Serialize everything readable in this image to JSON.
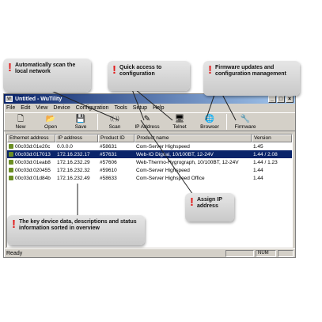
{
  "window": {
    "title": "Untitled - WuTility",
    "controls": {
      "minimize": "_",
      "maximize": "□",
      "close": "×"
    }
  },
  "menu": [
    "File",
    "Edit",
    "View",
    "Device",
    "Configuration",
    "Tools",
    "Setup",
    "Help"
  ],
  "toolbar": [
    {
      "label": "New",
      "icon": "new-document-icon",
      "glyph": "🗋"
    },
    {
      "label": "Open",
      "icon": "open-folder-icon",
      "glyph": "📂"
    },
    {
      "label": "Save",
      "icon": "save-disk-icon",
      "glyph": "💾"
    },
    {
      "label": "Scan",
      "icon": "scan-radar-icon",
      "glyph": "((·))"
    },
    {
      "label": "IP Address",
      "icon": "ip-address-icon",
      "glyph": "✎"
    },
    {
      "label": "Telnet",
      "icon": "telnet-terminal-icon",
      "glyph": "🖥"
    },
    {
      "label": "Browser",
      "icon": "browser-globe-icon",
      "glyph": "🌐"
    },
    {
      "label": "Firmware",
      "icon": "firmware-wrench-icon",
      "glyph": "🔧"
    }
  ],
  "table": {
    "columns": [
      "Ethernet address",
      "IP address",
      "Product ID",
      "Product name",
      "Version"
    ],
    "rows": [
      [
        "00c03d:01e20c",
        "0.0.0.0",
        "#58631",
        "Com-Server Highspeed",
        "1.45"
      ],
      [
        "00c03d:017013",
        "172.16.232.17",
        "#57631",
        "Web-IO Digital, 10/100BT, 12-24V",
        "1.44 / 2.08"
      ],
      [
        "00c03d:01eab8",
        "172.16.232.29",
        "#57606",
        "Web-Thermo-Hygrograph, 10/100BT, 12-24V",
        "1.44 / 1.23"
      ],
      [
        "00c03d:020455",
        "172.16.232.32",
        "#59610",
        "Com-Server Highspeed",
        "1.44"
      ],
      [
        "00c03d:01d84b",
        "172.16.232.49",
        "#58633",
        "Com-Server Highspeed Office",
        "1.44"
      ]
    ],
    "selected_row": 1
  },
  "statusbar": {
    "text": "Ready",
    "num": "NUM"
  },
  "callouts": {
    "scan": "Automatically scan the local network",
    "quick": "Quick access to configuration",
    "firmware": "Firmware updates and configuration management",
    "assign": "Assign IP address",
    "keydata": "The key device data, descriptions and status information sorted in overview"
  },
  "colors": {
    "accent": "#e21b1b",
    "selection": "#0a246a",
    "titlebar": "#0a246a"
  }
}
